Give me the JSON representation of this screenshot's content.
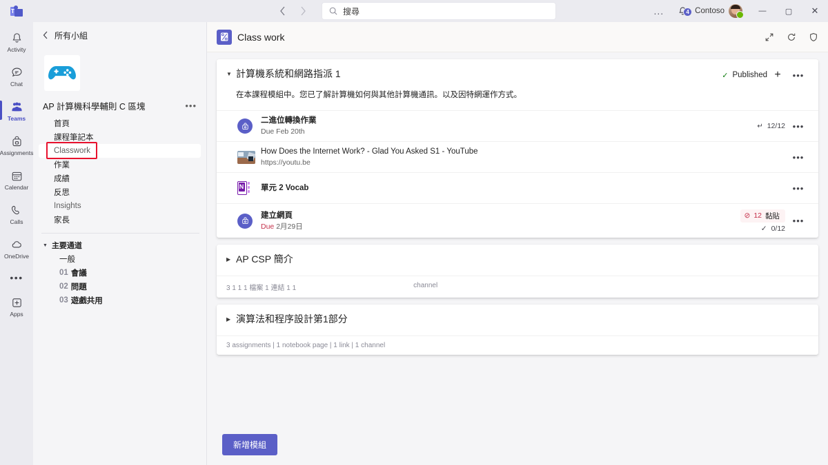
{
  "titlebar": {
    "back_icon": "chevron-left-icon",
    "forward_icon": "chevron-right-icon",
    "search_placeholder": "搜尋",
    "more_label": "...",
    "notification_count": "4",
    "org_name": "Contoso",
    "minimize_label": "—",
    "maximize_label": "▢",
    "close_label": "✕"
  },
  "rail": {
    "items": [
      {
        "label": "Activity",
        "icon": "bell-icon",
        "active": false
      },
      {
        "label": "Chat",
        "icon": "chat-icon",
        "active": false
      },
      {
        "label": "Teams",
        "icon": "teams-icon",
        "active": true
      },
      {
        "label": "Assignments",
        "icon": "backpack-icon",
        "active": false
      },
      {
        "label": "Calendar",
        "icon": "calendar-icon",
        "active": false
      },
      {
        "label": "Calls",
        "icon": "phone-icon",
        "active": false
      },
      {
        "label": "OneDrive",
        "icon": "cloud-icon",
        "active": false
      }
    ],
    "more_label": "•••",
    "apps_label": "Apps"
  },
  "sidebar": {
    "back_label": "所有小組",
    "team_name": "AP 計算機科學輔則 C 區塊",
    "team_more_label": "•••",
    "team_avatar_icon": "gamepad-icon",
    "nav_items": [
      {
        "label": "首頁",
        "selected": false,
        "muted": false,
        "annotated": false
      },
      {
        "label": "課程筆記本",
        "selected": false,
        "muted": false,
        "annotated": false
      },
      {
        "label": "Classwork",
        "selected": true,
        "muted": true,
        "annotated": true
      },
      {
        "label": "作業",
        "selected": false,
        "muted": false,
        "annotated": false
      },
      {
        "label": "成績",
        "selected": false,
        "muted": false,
        "annotated": false
      },
      {
        "label": "反思",
        "selected": false,
        "muted": false,
        "annotated": false
      },
      {
        "label": "Insights",
        "selected": false,
        "muted": true,
        "annotated": false
      },
      {
        "label": "家長",
        "selected": false,
        "muted": false,
        "annotated": false
      }
    ],
    "channel_group_label": "主要通道",
    "channels": [
      {
        "num": "",
        "label": "一般",
        "bold": false
      },
      {
        "num": "01",
        "label": "會議",
        "bold": true
      },
      {
        "num": "02",
        "label": "問題",
        "bold": true
      },
      {
        "num": "03",
        "label": "遊戲共用",
        "bold": true
      }
    ]
  },
  "main": {
    "tab_title": "Class work",
    "tab_icon": "classwork-icon",
    "header_icons": [
      "expand-icon",
      "refresh-icon",
      "shield-icon"
    ],
    "add_module_label": "新增模組",
    "modules": [
      {
        "title": "計算機系統和網路指派 1",
        "expanded": true,
        "description": "在本課程模組中。您已了解計算機如何與其他計算機通訊。以及因特網運作方式。",
        "published_label": "Published",
        "add_label": "+",
        "more_label": "•••",
        "meta": null,
        "items": [
          {
            "icon": "assignment-icon",
            "title": "二進位轉換作業",
            "subtitle": "Due Feb 20th",
            "subtitle_due_red": false,
            "turnin": "12/12",
            "pill": null,
            "graded": null,
            "more_label": "•••"
          },
          {
            "icon": "youtube-thumbnail-icon",
            "title": "How Does the Internet Work? - Glad You Asked S1 - YouTube",
            "subtitle": "https://youtu.be",
            "subtitle_due_red": false,
            "turnin": null,
            "pill": null,
            "graded": null,
            "more_label": "•••"
          },
          {
            "icon": "onenote-icon",
            "title": "單元 2 Vocab",
            "subtitle": null,
            "subtitle_due_red": false,
            "turnin": null,
            "pill": null,
            "graded": null,
            "more_label": "•••"
          },
          {
            "icon": "assignment-icon",
            "title": "建立網頁",
            "subtitle_prefix": "Due",
            "subtitle": "2月29日",
            "subtitle_due_red": true,
            "turnin": null,
            "pill": {
              "count": "12",
              "label": "黏貼"
            },
            "graded": "0/12",
            "more_label": "•••"
          }
        ]
      },
      {
        "title": "AP CSP 簡介",
        "expanded": false,
        "description": null,
        "meta": "3 1 1 1 檔案 1 連結 1 1",
        "meta_extra": "channel",
        "items": []
      },
      {
        "title": "演算法和程序設計第1部分",
        "expanded": false,
        "description": null,
        "meta": "3 assignments  |  1 notebook page  |  1 link  |  1 channel",
        "meta_extra": null,
        "items": []
      }
    ]
  }
}
